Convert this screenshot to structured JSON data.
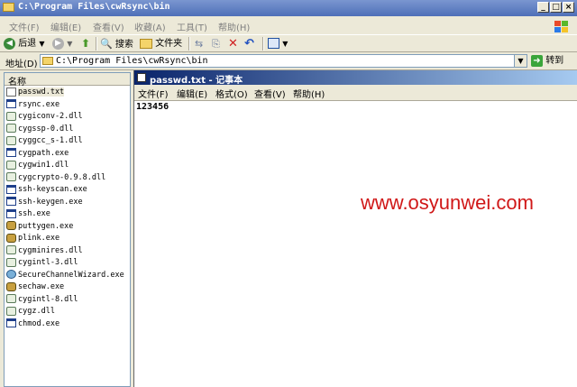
{
  "explorer": {
    "title": "C:\\Program Files\\cwRsync\\bin",
    "menu": [
      "文件(F)",
      "编辑(E)",
      "查看(V)",
      "收藏(A)",
      "工具(T)",
      "帮助(H)"
    ],
    "toolbar": {
      "back": "后退",
      "search": "搜索",
      "folders": "文件夹"
    },
    "address_label": "地址(D)",
    "address_value": "C:\\Program Files\\cwRsync\\bin",
    "go": "转到",
    "column_header": "名称",
    "files": [
      {
        "name": "passwd.txt",
        "icon": "text-file-icon"
      },
      {
        "name": "rsync.exe",
        "icon": "exe-icon"
      },
      {
        "name": "cygiconv-2.dll",
        "icon": "dll-icon"
      },
      {
        "name": "cygssp-0.dll",
        "icon": "dll-icon"
      },
      {
        "name": "cyggcc_s-1.dll",
        "icon": "dll-icon"
      },
      {
        "name": "cygpath.exe",
        "icon": "exe-icon"
      },
      {
        "name": "cygwin1.dll",
        "icon": "dll-icon"
      },
      {
        "name": "cygcrypto-0.9.8.dll",
        "icon": "dll-icon"
      },
      {
        "name": "ssh-keyscan.exe",
        "icon": "exe-icon"
      },
      {
        "name": "ssh-keygen.exe",
        "icon": "exe-icon"
      },
      {
        "name": "ssh.exe",
        "icon": "exe-icon"
      },
      {
        "name": "puttygen.exe",
        "icon": "app-icon"
      },
      {
        "name": "plink.exe",
        "icon": "app-icon"
      },
      {
        "name": "cygminires.dll",
        "icon": "dll-icon"
      },
      {
        "name": "cygintl-3.dll",
        "icon": "dll-icon"
      },
      {
        "name": "SecureChannelWizard.exe",
        "icon": "globe-icon"
      },
      {
        "name": "sechaw.exe",
        "icon": "app-icon"
      },
      {
        "name": "cygintl-8.dll",
        "icon": "dll-icon"
      },
      {
        "name": "cygz.dll",
        "icon": "dll-icon"
      },
      {
        "name": "chmod.exe",
        "icon": "exe-icon"
      }
    ]
  },
  "notepad": {
    "title": "passwd.txt - 记事本",
    "menu": [
      "文件(F)",
      "编辑(E)",
      "格式(O)",
      "查看(V)",
      "帮助(H)"
    ],
    "content": "123456"
  },
  "watermark": "www.osyunwei.com"
}
